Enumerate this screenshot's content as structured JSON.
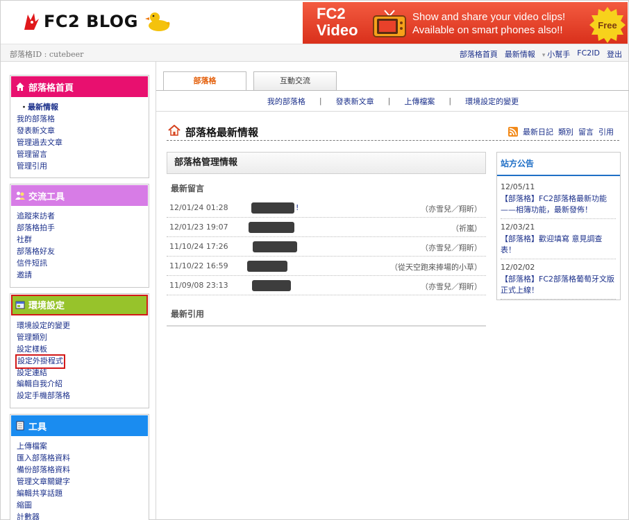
{
  "header": {
    "logo_text": "FC2 BLOG",
    "banner": {
      "brand_line1": "FC2",
      "brand_line2": "Video",
      "message_line1": "Show and share your video clips!",
      "message_line2": "Available on smart phones also!!",
      "badge": "Free"
    }
  },
  "subbar": {
    "blog_id": "部落格ID : cutebeer",
    "links": {
      "blog_home": "部落格首頁",
      "news": "最新情報",
      "help": "小幫手",
      "fc2id": "FC2ID",
      "logout": "登出"
    }
  },
  "sidebar": {
    "home": {
      "title": "部落格首頁",
      "items": [
        "最新情報",
        "我的部落格",
        "發表新文章",
        "管理過去文章",
        "管理留言",
        "管理引用"
      ]
    },
    "community": {
      "title": "交流工具",
      "items": [
        "追蹤來訪者",
        "部落格拍手",
        "社群",
        "部落格好友",
        "信件短訊",
        "邀請"
      ]
    },
    "settings": {
      "title": "環境設定",
      "items": [
        "環境設定的變更",
        "管理類別",
        "設定樣板",
        "設定外掛程式",
        "設定連結",
        "編輯自我介紹",
        "設定手機部落格"
      ]
    },
    "tools": {
      "title": "工具",
      "items": [
        "上傳檔案",
        "匯入部落格資料",
        "備份部落格資料",
        "管理文章關鍵字",
        "編輯共享話題",
        "縮圖",
        "計數器"
      ]
    }
  },
  "tabs": [
    "部落格",
    "互動交流"
  ],
  "subnav": [
    "我的部落格",
    "發表新文章",
    "上傳檔案",
    "環境設定的變更"
  ],
  "page": {
    "title": "部落格最新情報",
    "links": [
      "最新日記",
      "類別",
      "留言",
      "引用"
    ]
  },
  "admin": {
    "title": "部落格管理情報",
    "comments_title": "最新留言",
    "comments": [
      {
        "date": "12/01/24 01:28",
        "tail": "!",
        "author": "（亦雪兒／翔昕）"
      },
      {
        "date": "12/01/23 19:07",
        "tail": "",
        "author": "（祈嵐）"
      },
      {
        "date": "11/10/24 17:26",
        "tail": "",
        "author": "（亦雪兒／翔昕）"
      },
      {
        "date": "11/10/22 16:59",
        "tail": "",
        "author": "（從天空跑來捧場的小草）"
      },
      {
        "date": "11/09/08 23:13",
        "tail": "",
        "author": "（亦雪兒／翔昕）"
      }
    ],
    "trackbacks_title": "最新引用"
  },
  "notice": {
    "title": "站方公告",
    "items": [
      {
        "date": "12/05/11",
        "text": "【部落格】FC2部落格最新功能——相簿功能，最新發佈！"
      },
      {
        "date": "12/03/21",
        "text": "【部落格】歡迎填寫 意見調查表！"
      },
      {
        "date": "12/02/02",
        "text": "【部落格】FC2部落格葡萄牙文版正式上線！"
      }
    ]
  },
  "colors": {
    "home": "#e8106f",
    "community": "#d77ce6",
    "settings": "#97c32b",
    "tools": "#1a8cf0",
    "highlight": "#d21818",
    "active_tab": "#e4600c",
    "banner": "#e0391f"
  }
}
